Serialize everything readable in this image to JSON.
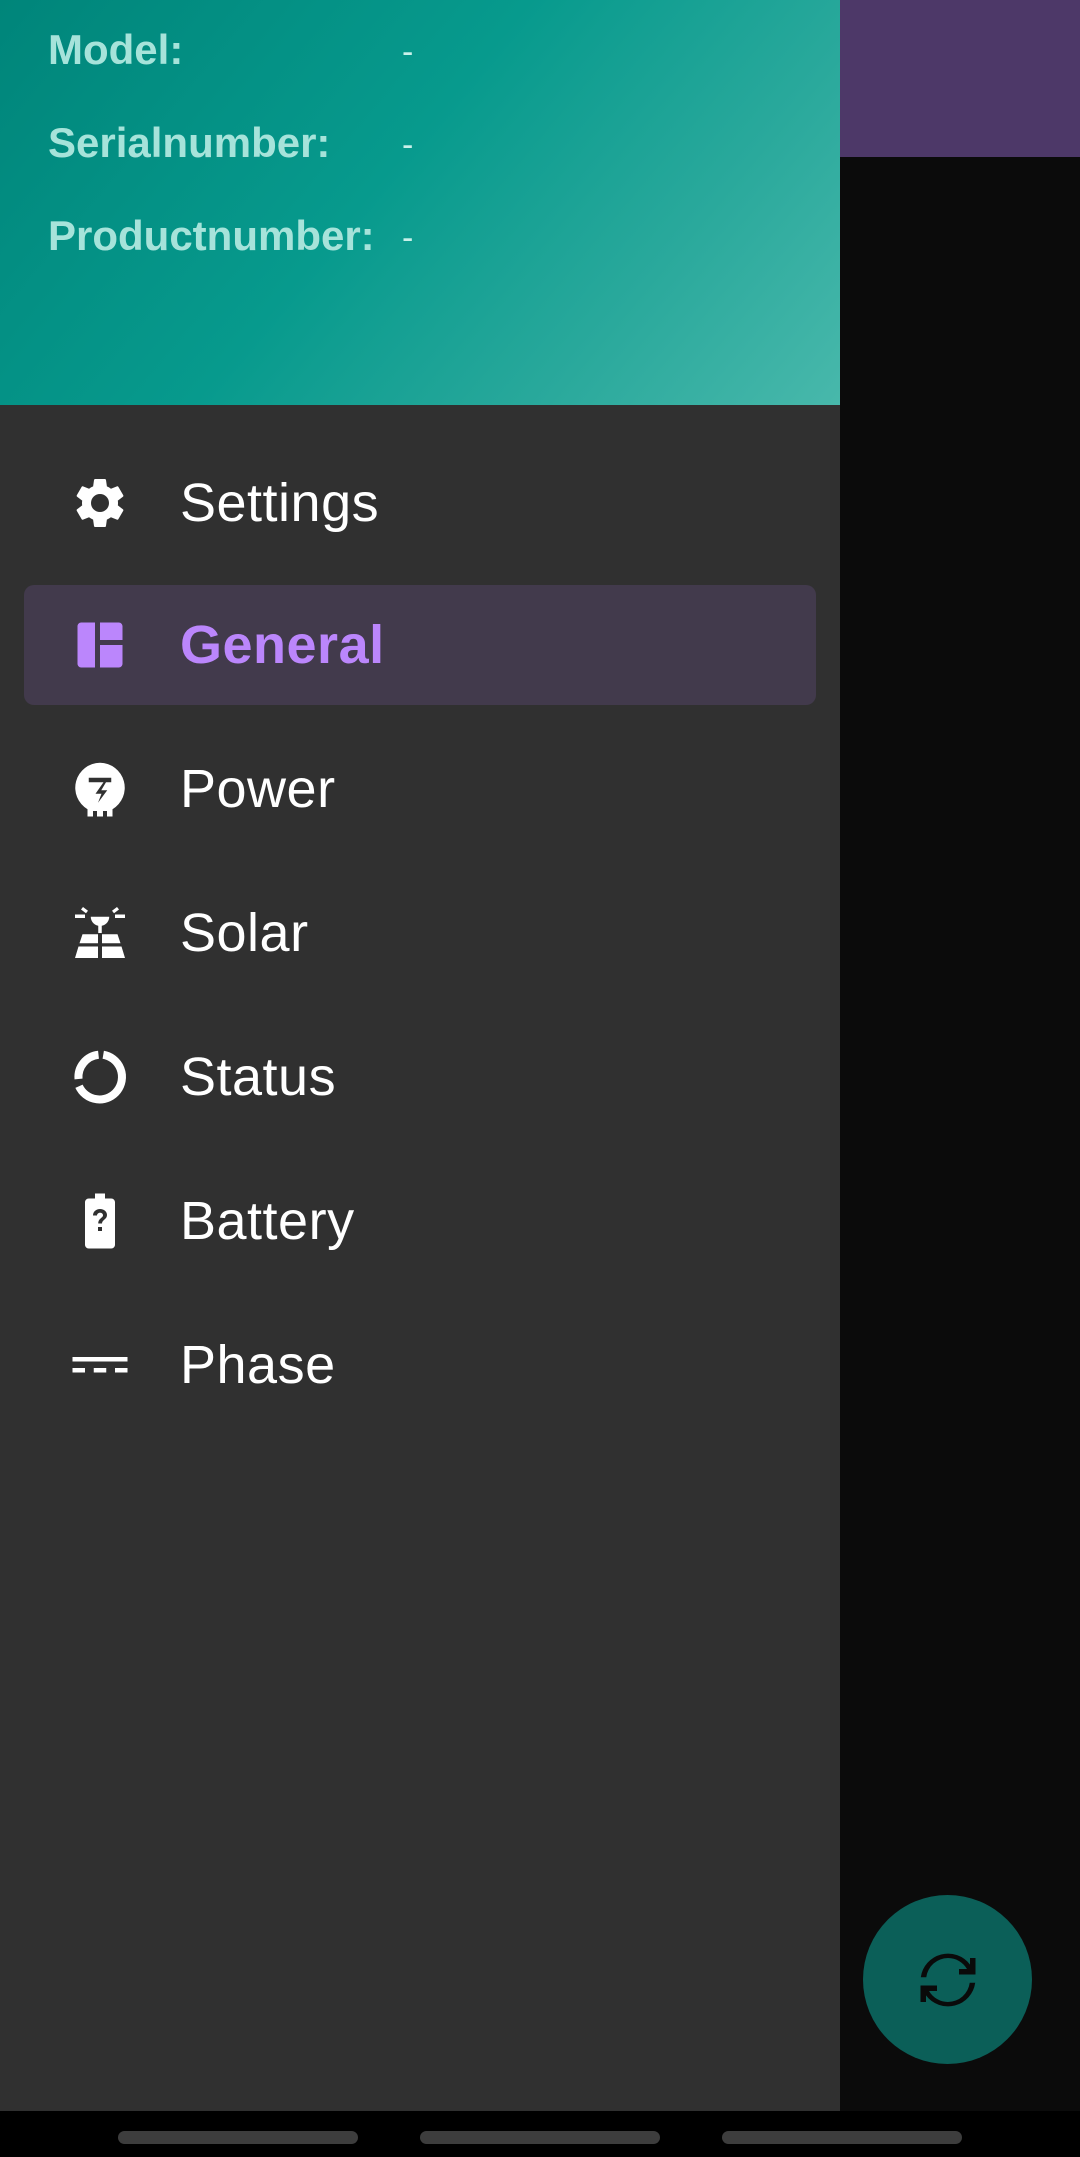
{
  "header": {
    "fields": [
      {
        "label": "Model:",
        "value": "-"
      },
      {
        "label": "Serialnumber:",
        "value": "-"
      },
      {
        "label": "Productnumber:",
        "value": "-"
      }
    ]
  },
  "menu": {
    "items": [
      {
        "label": "Settings",
        "icon": "gear-icon"
      },
      {
        "label": "General",
        "icon": "dashboard-icon",
        "selected": true
      },
      {
        "label": "Power",
        "icon": "power-plug-icon"
      },
      {
        "label": "Solar",
        "icon": "solar-panel-icon"
      },
      {
        "label": "Status",
        "icon": "progress-ring-icon"
      },
      {
        "label": "Battery",
        "icon": "battery-unknown-icon"
      },
      {
        "label": "Phase",
        "icon": "phase-dashes-icon"
      }
    ]
  },
  "fab": {
    "icon": "refresh-icon"
  },
  "colors": {
    "header_gradient_start": "#00857a",
    "header_gradient_end": "#48b8ab",
    "drawer_bg": "#303030",
    "selected_bg": "#423a4c",
    "accent": "#bb86fc",
    "toolbar": "#4d3868",
    "fab": "#0b5f58"
  }
}
